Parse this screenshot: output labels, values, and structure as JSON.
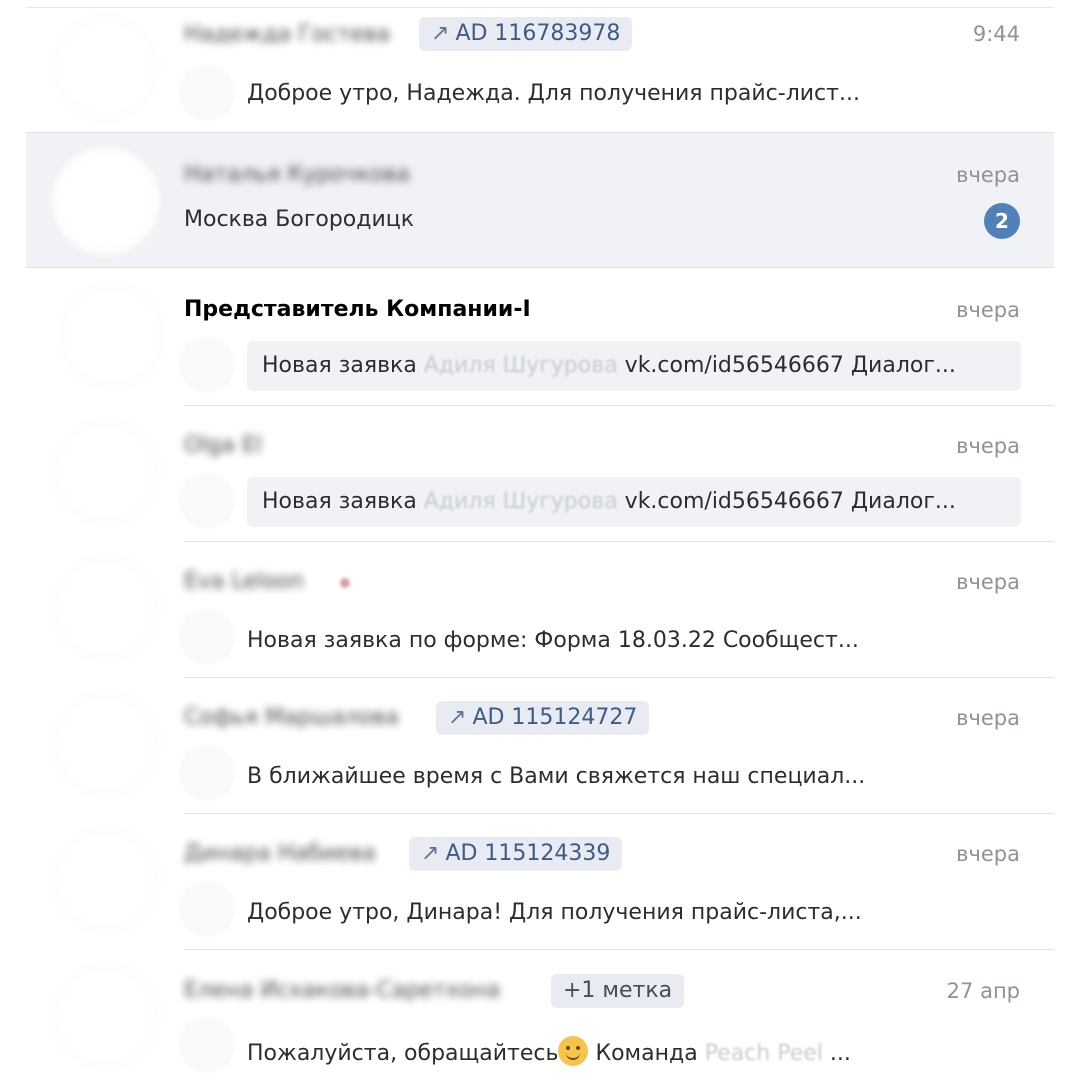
{
  "conversations": [
    {
      "name": "Надежда Гостева",
      "tag": "AD 116783978",
      "time": "9:44",
      "message": "Доброе утро, Надежда. Для получения прайс-лист..."
    },
    {
      "name": "Наталья Курочкова",
      "time": "вчера",
      "message": "Москва Богородицк",
      "unread": "2"
    },
    {
      "name": "Представитель Компании-I",
      "time": "вчера",
      "message_prefix": "Новая заявка",
      "message_hidden": "Адиля Шугурова",
      "message_suffix": "vk.com/id56546667 Диалог..."
    },
    {
      "name": "Olga El",
      "time": "вчера",
      "message_prefix": "Новая заявка",
      "message_hidden": "Адиля Шугурова",
      "message_suffix": "vk.com/id56546667 Диалог..."
    },
    {
      "name": "Eva Leloon",
      "time": "вчера",
      "message": "Новая заявка по форме: Форма 18.03.22 Сообщест..."
    },
    {
      "name": "Софья Маршалова",
      "tag": "AD 115124727",
      "time": "вчера",
      "message": "В ближайшее время с Вами свяжется наш специал..."
    },
    {
      "name": "Динара Набиева",
      "tag": "AD 115124339",
      "time": "вчера",
      "message": "Доброе утро, Динара! Для получения прайс-листа,..."
    },
    {
      "name": "Елена Исхакова-Саретхона",
      "tag": "+1 метка",
      "time": "27 апр",
      "message_prefix": "Пожалуйста, обращайтесь",
      "message_middle": " Команда ",
      "message_hidden": "Peach Peel",
      "message_suffix": " ..."
    }
  ],
  "icons": {
    "ad_tag": "external-link-arrow-icon",
    "emoji": "smiling-face-emoji-icon"
  },
  "colors": {
    "accent": "#5181b8",
    "tag_bg": "#e8ebf1",
    "tag_text": "#3e5c86",
    "selected_bg": "#f0f2f5"
  }
}
